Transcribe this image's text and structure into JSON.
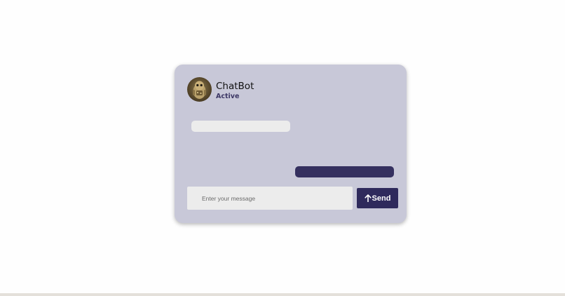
{
  "chat": {
    "bot_name": "ChatBot",
    "status": "Active",
    "avatar_icon": "robot-avatar-icon",
    "messages": [
      {
        "from": "bot",
        "text": ""
      },
      {
        "from": "user",
        "text": ""
      }
    ],
    "input": {
      "value": "",
      "placeholder": "Enter your message"
    },
    "send_button": {
      "label": "Send",
      "icon": "arrow-up-icon"
    }
  },
  "colors": {
    "card_background": "#c8c8d8",
    "accent": "#2f2a5c",
    "status_text": "#3d3866",
    "received_bubble": "#ececec",
    "sent_bubble": "#35305f"
  }
}
